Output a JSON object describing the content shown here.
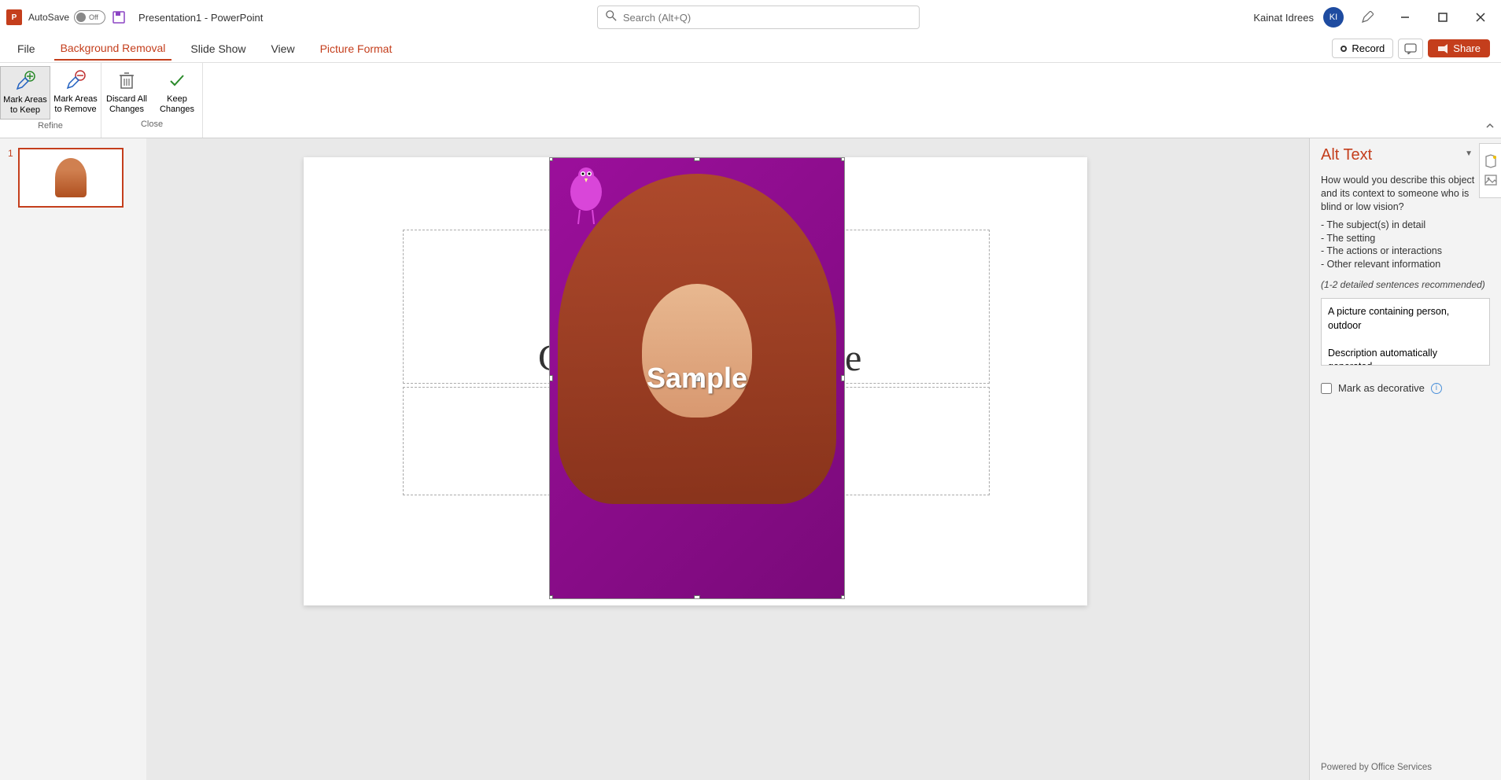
{
  "titlebar": {
    "autosave_label": "AutoSave",
    "autosave_state": "Off",
    "doc_title": "Presentation1  -  PowerPoint",
    "search_placeholder": "Search (Alt+Q)",
    "username": "Kainat Idrees",
    "avatar_initials": "KI"
  },
  "tabs": {
    "file": "File",
    "bg_removal": "Background Removal",
    "slide_show": "Slide Show",
    "view": "View",
    "picture_format": "Picture Format",
    "record": "Record",
    "share": "Share"
  },
  "ribbon": {
    "mark_keep_l1": "Mark Areas",
    "mark_keep_l2": "to Keep",
    "mark_remove_l1": "Mark Areas",
    "mark_remove_l2": "to Remove",
    "discard_l1": "Discard All",
    "discard_l2": "Changes",
    "keep_l1": "Keep",
    "keep_l2": "Changes",
    "group_refine": "Refine",
    "group_close": "Close"
  },
  "thumbnails": {
    "slide1_num": "1"
  },
  "slide": {
    "title_partial_left": "C",
    "title_partial_right": "e",
    "sample_watermark": "Sample"
  },
  "altpane": {
    "title": "Alt Text",
    "question": "How would you describe this object and its context to someone who is blind or low vision?",
    "bullet1": "- The subject(s) in detail",
    "bullet2": "- The setting",
    "bullet3": "- The actions or interactions",
    "bullet4": "- Other relevant information",
    "hint": "(1-2 detailed sentences recommended)",
    "textarea_value": "A picture containing person, outdoor\n\nDescription automatically generated",
    "decorative_label": "Mark as decorative",
    "footer": "Powered by Office Services"
  }
}
